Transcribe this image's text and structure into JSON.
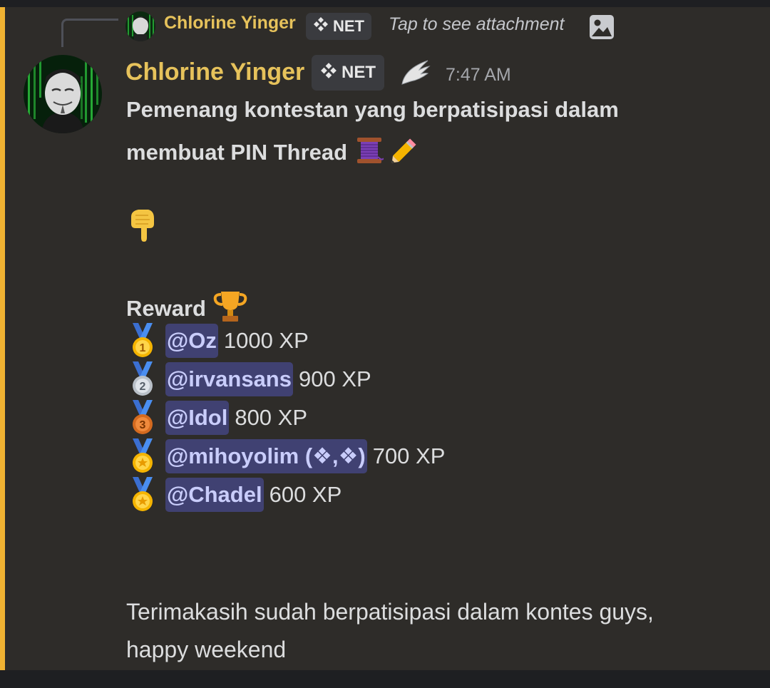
{
  "reply": {
    "author": "Chlorine Yinger",
    "tag": "NET",
    "text": "Tap to see attachment",
    "attachment_icon": "image-icon"
  },
  "message": {
    "author": "Chlorine Yinger",
    "tag": "NET",
    "badge_icon": "wing-icon",
    "timestamp": "7:47 AM",
    "title_line1": "Pemenang kontestan yang berpatisipasi dalam",
    "title_line2": "membuat PIN Thread",
    "title_emojis": [
      "thread-spool-icon",
      "pencil-icon"
    ],
    "pointing_emoji": "pointing-down-icon",
    "reward_heading": "Reward",
    "reward_emoji": "trophy-icon",
    "rankings": [
      {
        "medal": "1",
        "mention": "@Oz",
        "xp": "1000 XP"
      },
      {
        "medal": "2",
        "mention": "@irvansans",
        "xp": "900 XP"
      },
      {
        "medal": "3",
        "mention": "@Idol",
        "xp": "800 XP"
      },
      {
        "medal": "star",
        "mention": "@mihoyolim (❖,❖)",
        "xp": "700 XP"
      },
      {
        "medal": "star",
        "mention": "@Chadel",
        "xp": "600 XP"
      }
    ],
    "closing_line1": "Terimakasih sudah berpatisipasi dalam kontes guys,",
    "closing_line2": "happy weekend"
  },
  "colors": {
    "accent_bar": "#f0b232",
    "author": "#e6c25b",
    "mention_bg": "#404172",
    "mention_text": "#c9cdfb",
    "background": "#2e2c29"
  }
}
